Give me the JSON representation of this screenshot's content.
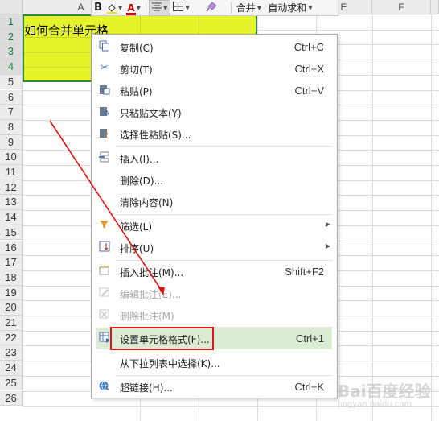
{
  "sheet": {
    "columns": [
      "A",
      "E",
      "F"
    ],
    "rows": [
      "1",
      "2",
      "3",
      "4",
      "5",
      "6",
      "7",
      "8",
      "9",
      "10",
      "11",
      "12",
      "13",
      "14",
      "15",
      "16",
      "17",
      "18",
      "19",
      "20",
      "21",
      "22",
      "23",
      "24",
      "25",
      "26"
    ],
    "cell_a1": "如何合并单元格"
  },
  "toolbar": {
    "bold": "B",
    "fill_icon": "fill-color-icon",
    "font_color": "A",
    "align_icon": "align-center-icon",
    "border_icon": "border-icon",
    "eraser_icon": "format-painter-icon",
    "merge_label": "合并",
    "autosum_label": "自动求和"
  },
  "menu": {
    "items": [
      {
        "label": "复制(C)",
        "shortcut": "Ctrl+C",
        "icon": "copy-icon"
      },
      {
        "label": "剪切(T)",
        "shortcut": "Ctrl+X",
        "icon": "scissors-icon"
      },
      {
        "label": "粘贴(P)",
        "shortcut": "Ctrl+V",
        "icon": "paste-icon"
      },
      {
        "label": "只粘贴文本(Y)",
        "icon": "paste-text-icon"
      },
      {
        "label": "选择性粘贴(S)...",
        "icon": "paste-special-icon"
      },
      {
        "label": "插入(I)...",
        "icon": "insert-icon"
      },
      {
        "label": "删除(D)...",
        "icon": ""
      },
      {
        "label": "清除内容(N)",
        "icon": ""
      },
      {
        "label": "筛选(L)",
        "icon": "filter-icon"
      },
      {
        "label": "排序(U)",
        "icon": "sort-icon"
      },
      {
        "label": "插入批注(M)...",
        "shortcut": "Shift+F2",
        "icon": "insert-comment-icon"
      },
      {
        "label": "编辑批注(E)...",
        "icon": "edit-comment-icon"
      },
      {
        "label": "删除批注(M)",
        "icon": "delete-comment-icon"
      },
      {
        "label": "设置单元格格式(F)...",
        "shortcut": "Ctrl+1",
        "icon": "format-cells-icon"
      },
      {
        "label": "从下拉列表中选择(K)...",
        "icon": ""
      },
      {
        "label": "超链接(H)...",
        "shortcut": "Ctrl+K",
        "icon": "hyperlink-icon"
      }
    ]
  },
  "watermark": {
    "text": "Bai百度经验",
    "sub": "jingyan.baidu.com"
  },
  "colors": {
    "fill": "#e4f32a",
    "selection": "#2f8a3e",
    "highlight": "#dcebd4",
    "annotation": "#e01616"
  }
}
